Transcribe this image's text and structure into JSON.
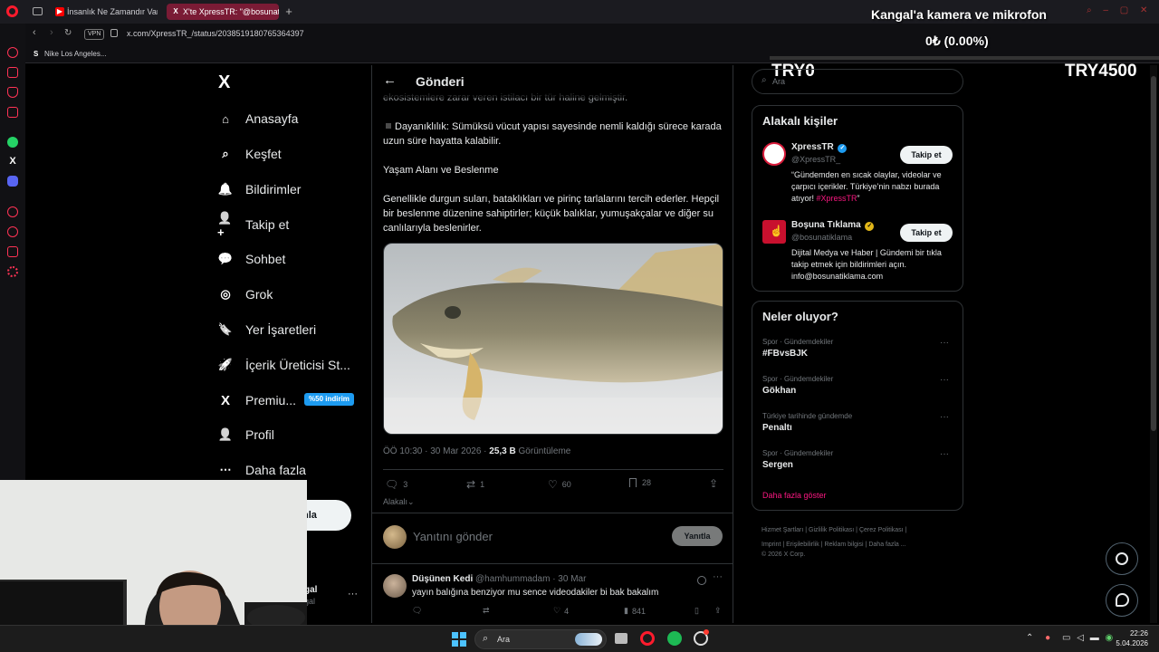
{
  "browser": {
    "tabs": [
      {
        "label": "İnsanlık Ne Zamandır Var?",
        "icon": "youtube-icon"
      },
      {
        "label": "X'te XpressTR: \"@bosunat",
        "icon": "x-logo-icon"
      }
    ],
    "url": "x.com/XpressTR_/status/2038519180765364397",
    "vpn": "VPN",
    "bookmark": "Nike Los Angeles..."
  },
  "overlay": {
    "title": "Kangal'a kamera ve mikrofon",
    "progress": "0₺ (0.00%)",
    "left_amount": "TRY0",
    "right_amount": "TRY4500",
    "progress_fraction": 0
  },
  "nav": {
    "items": [
      {
        "label": "Anasayfa",
        "icon": "home-icon"
      },
      {
        "label": "Keşfet",
        "icon": "search-icon"
      },
      {
        "label": "Bildirimler",
        "icon": "bell-icon"
      },
      {
        "label": "Takip et",
        "icon": "follow-icon"
      },
      {
        "label": "Sohbet",
        "icon": "chat-icon"
      },
      {
        "label": "Grok",
        "icon": "grok-icon"
      },
      {
        "label": "Yer İşaretleri",
        "icon": "bookmark-icon"
      },
      {
        "label": "İçerik Üreticisi St...",
        "icon": "rocket-icon"
      },
      {
        "label": "Premiu...",
        "icon": "x-logo-icon"
      },
      {
        "label": "Profil",
        "icon": "person-icon"
      },
      {
        "label": "Daha fazla",
        "icon": "more-circle-icon"
      }
    ],
    "premium_badge": "%50 indirim",
    "post_button_partial": "nla",
    "account_partial": "gal",
    "account_handle_partial": "gal"
  },
  "post": {
    "header_title": "Gönderi",
    "text_cut": "ekosistemlere zarar veren istilacı bir tür haline gelmiştir.",
    "bullet": "Dayanıklılık: Sümüksü vücut yapısı sayesinde nemli kaldığı sürece karada uzun süre hayatta kalabilir.",
    "section_heading": "Yaşam Alanı ve Beslenme",
    "paragraph": "Genellikle durgun suları, bataklıkları ve pirinç tarlalarını tercih ederler. Hepçil bir beslenme düzenine sahiptirler; küçük balıklar, yumuşakçalar ve diğer su canlılarıyla beslenirler.",
    "time": "ÖÖ 10:30 · 30 Mar 2026 · ",
    "views_count": "25,3 B",
    "views_label": " Görüntüleme",
    "replies": "3",
    "reposts": "1",
    "likes": "60",
    "bookmarks": "28",
    "sort_label": "Alakalı",
    "reply_placeholder": "Yanıtını gönder",
    "reply_button": "Yanıtla"
  },
  "reply": {
    "name": "Düşünen Kedi",
    "handle": "@hamhummadam",
    "date": "· 30 Mar",
    "text": "yayın balığına benziyor mu sence videodakiler bi bak bakalım",
    "likes": "4",
    "views": "841"
  },
  "search": {
    "placeholder": "Ara"
  },
  "related": {
    "title": "Alakalı kişiler",
    "people": [
      {
        "name": "XpressTR",
        "handle": "@XpressTR_",
        "bio_before": "“Gündemden en sıcak olaylar, videolar ve çarpıcı içerikler. Türkiye’nin nabzı burada atıyor! ",
        "bio_tag": "#XpressTR",
        "bio_after": "”",
        "follow": "Takip et"
      },
      {
        "name": "Boşuna Tıklama",
        "handle": "@bosunatiklama",
        "bio": "Dijital Medya ve Haber | Gündemi bir tıkla takip etmek için bildirimleri açın. info@bosunatiklama.com",
        "follow": "Takip et"
      }
    ]
  },
  "trends": {
    "title": "Neler oluyor?",
    "items": [
      {
        "category": "Spor · Gündemdekiler",
        "name": "#FBvsBJK"
      },
      {
        "category": "Spor · Gündemdekiler",
        "name": "Gökhan"
      },
      {
        "category": "Türkiye tarihinde gündemde",
        "name": "Penaltı"
      },
      {
        "category": "Spor · Gündemdekiler",
        "name": "Sergen"
      }
    ],
    "show_more": "Daha fazla göster"
  },
  "footer": {
    "links": [
      "Hizmet Şartları",
      "Gizlilik Politikası",
      "Çerez Politikası",
      "Imprint",
      "Erişilebilirlik",
      "Reklam bilgisi",
      "Daha fazla ..."
    ],
    "copyright": "© 2026 X Corp."
  },
  "taskbar": {
    "search_label": "Ara",
    "time": "22:26",
    "date": "5.04.2026"
  },
  "colors": {
    "accent_pink": "#f91880",
    "x_blue": "#1d9bf0",
    "opera_red": "#ff1b2d",
    "tab_active": "#7a1b35"
  }
}
